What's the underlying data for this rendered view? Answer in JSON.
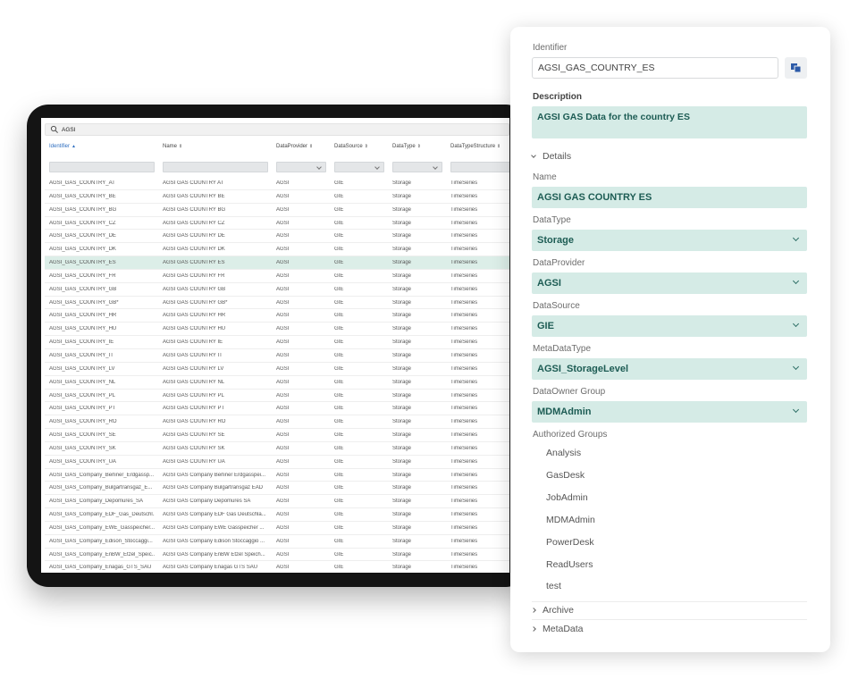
{
  "table": {
    "search_value": "AGSI",
    "columns": [
      {
        "label": "Identifier",
        "sort": "▲",
        "active": true
      },
      {
        "label": "Name",
        "sort": "⇕",
        "active": false
      },
      {
        "label": "DataProvider",
        "sort": "⇕",
        "active": false
      },
      {
        "label": "DataSource",
        "sort": "⇕",
        "active": false
      },
      {
        "label": "DataType",
        "sort": "⇕",
        "active": false
      },
      {
        "label": "DataTypeStructure",
        "sort": "⇕",
        "active": false
      }
    ],
    "rows": [
      [
        "AGSI_GAS_COUNTRY_AT",
        "AGSI GAS COUNTRY AT",
        "AGSI",
        "GIE",
        "Storage",
        "TimeSeries"
      ],
      [
        "AGSI_GAS_COUNTRY_BE",
        "AGSI GAS COUNTRY BE",
        "AGSI",
        "GIE",
        "Storage",
        "TimeSeries"
      ],
      [
        "AGSI_GAS_COUNTRY_BG",
        "AGSI GAS COUNTRY BG",
        "AGSI",
        "GIE",
        "Storage",
        "TimeSeries"
      ],
      [
        "AGSI_GAS_COUNTRY_CZ",
        "AGSI GAS COUNTRY CZ",
        "AGSI",
        "GIE",
        "Storage",
        "TimeSeries"
      ],
      [
        "AGSI_GAS_COUNTRY_DE",
        "AGSI GAS COUNTRY DE",
        "AGSI",
        "GIE",
        "Storage",
        "TimeSeries"
      ],
      [
        "AGSI_GAS_COUNTRY_DK",
        "AGSI GAS COUNTRY DK",
        "AGSI",
        "GIE",
        "Storage",
        "TimeSeries"
      ],
      [
        "AGSI_GAS_COUNTRY_ES",
        "AGSI GAS COUNTRY ES",
        "AGSI",
        "GIE",
        "Storage",
        "TimeSeries"
      ],
      [
        "AGSI_GAS_COUNTRY_FR",
        "AGSI GAS COUNTRY FR",
        "AGSI",
        "GIE",
        "Storage",
        "TimeSeries"
      ],
      [
        "AGSI_GAS_COUNTRY_GB",
        "AGSI GAS COUNTRY GB",
        "AGSI",
        "GIE",
        "Storage",
        "TimeSeries"
      ],
      [
        "AGSI_GAS_COUNTRY_GB*",
        "AGSI GAS COUNTRY GB*",
        "AGSI",
        "GIE",
        "Storage",
        "TimeSeries"
      ],
      [
        "AGSI_GAS_COUNTRY_HR",
        "AGSI GAS COUNTRY HR",
        "AGSI",
        "GIE",
        "Storage",
        "TimeSeries"
      ],
      [
        "AGSI_GAS_COUNTRY_HU",
        "AGSI GAS COUNTRY HU",
        "AGSI",
        "GIE",
        "Storage",
        "TimeSeries"
      ],
      [
        "AGSI_GAS_COUNTRY_IE",
        "AGSI GAS COUNTRY IE",
        "AGSI",
        "GIE",
        "Storage",
        "TimeSeries"
      ],
      [
        "AGSI_GAS_COUNTRY_IT",
        "AGSI GAS COUNTRY IT",
        "AGSI",
        "GIE",
        "Storage",
        "TimeSeries"
      ],
      [
        "AGSI_GAS_COUNTRY_LV",
        "AGSI GAS COUNTRY LV",
        "AGSI",
        "GIE",
        "Storage",
        "TimeSeries"
      ],
      [
        "AGSI_GAS_COUNTRY_NL",
        "AGSI GAS COUNTRY NL",
        "AGSI",
        "GIE",
        "Storage",
        "TimeSeries"
      ],
      [
        "AGSI_GAS_COUNTRY_PL",
        "AGSI GAS COUNTRY PL",
        "AGSI",
        "GIE",
        "Storage",
        "TimeSeries"
      ],
      [
        "AGSI_GAS_COUNTRY_PT",
        "AGSI GAS COUNTRY PT",
        "AGSI",
        "GIE",
        "Storage",
        "TimeSeries"
      ],
      [
        "AGSI_GAS_COUNTRY_RO",
        "AGSI GAS COUNTRY RO",
        "AGSI",
        "GIE",
        "Storage",
        "TimeSeries"
      ],
      [
        "AGSI_GAS_COUNTRY_SE",
        "AGSI GAS COUNTRY SE",
        "AGSI",
        "GIE",
        "Storage",
        "TimeSeries"
      ],
      [
        "AGSI_GAS_COUNTRY_SK",
        "AGSI GAS COUNTRY SK",
        "AGSI",
        "GIE",
        "Storage",
        "TimeSeries"
      ],
      [
        "AGSI_GAS_COUNTRY_UA",
        "AGSI GAS COUNTRY UA",
        "AGSI",
        "GIE",
        "Storage",
        "TimeSeries"
      ],
      [
        "AGSI_GAS_Company_Berliner_Erdgassp...",
        "AGSI GAS Company Berliner Erdgasspei...",
        "AGSI",
        "GIE",
        "Storage",
        "TimeSeries"
      ],
      [
        "AGSI_GAS_Company_Bulgartransgaz_E...",
        "AGSI GAS Company Bulgartransgaz EAD",
        "AGSI",
        "GIE",
        "Storage",
        "TimeSeries"
      ],
      [
        "AGSI_GAS_Company_Depomures_SA",
        "AGSI GAS Company Depomures SA",
        "AGSI",
        "GIE",
        "Storage",
        "TimeSeries"
      ],
      [
        "AGSI_GAS_Company_EDF_Gas_Deutschl...",
        "AGSI GAS Company EDF Gas Deutschla...",
        "AGSI",
        "GIE",
        "Storage",
        "TimeSeries"
      ],
      [
        "AGSI_GAS_Company_EWE_Gasspeicher...",
        "AGSI GAS Company EWE Gasspeicher ...",
        "AGSI",
        "GIE",
        "Storage",
        "TimeSeries"
      ],
      [
        "AGSI_GAS_Company_Edison_Stoccaggi...",
        "AGSI GAS Company Edison Stoccaggio ...",
        "AGSI",
        "GIE",
        "Storage",
        "TimeSeries"
      ],
      [
        "AGSI_GAS_Company_EnBW_Etzel_Speic...",
        "AGSI GAS Company EnBW Etzel Speich...",
        "AGSI",
        "GIE",
        "Storage",
        "TimeSeries"
      ],
      [
        "AGSI_GAS_Company_Enagas_GTS_SAU",
        "AGSI GAS Company Enagas GTS SAU",
        "AGSI",
        "GIE",
        "Storage",
        "TimeSeries"
      ]
    ],
    "selected_row_index": 6
  },
  "detail": {
    "identifier_label": "Identifier",
    "identifier_value": "AGSI_GAS_COUNTRY_ES",
    "description_label": "Description",
    "description_value": "AGSI GAS Data for the country ES",
    "details_label": "Details",
    "name_label": "Name",
    "name_value": "AGSI GAS COUNTRY ES",
    "datatype_label": "DataType",
    "datatype_value": "Storage",
    "dataprovider_label": "DataProvider",
    "dataprovider_value": "AGSI",
    "datasource_label": "DataSource",
    "datasource_value": "GIE",
    "metadatatype_label": "MetaDataType",
    "metadatatype_value": "AGSI_StorageLevel",
    "dataowner_label": "DataOwner Group",
    "dataowner_value": "MDMAdmin",
    "authorized_label": "Authorized Groups",
    "authorized_groups": [
      "Analysis",
      "GasDesk",
      "JobAdmin",
      "MDMAdmin",
      "PowerDesk",
      "ReadUsers",
      "test"
    ],
    "archive_label": "Archive",
    "metadata_label": "MetaData"
  },
  "colors": {
    "accent_teal_bg": "#d5ebe6",
    "accent_teal_text": "#1d5c54",
    "selected_row": "#dceee8",
    "sort_active": "#2f6fc0",
    "copy_icon": "#2c5aa8"
  }
}
